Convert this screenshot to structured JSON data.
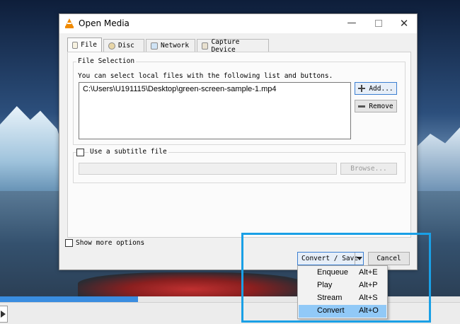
{
  "window": {
    "title": "Open Media"
  },
  "tabs": [
    {
      "label": "File",
      "icon": "file-icon"
    },
    {
      "label": "Disc",
      "icon": "disc-icon"
    },
    {
      "label": "Network",
      "icon": "network-icon"
    },
    {
      "label": "Capture Device",
      "icon": "capture-device-icon"
    }
  ],
  "file_selection": {
    "group_label": "File Selection",
    "instructions": "You can select local files with the following list and buttons.",
    "files": [
      "C:\\Users\\U191115\\Desktop\\green-screen-sample-1.mp4"
    ],
    "add_label": "Add...",
    "remove_label": "Remove"
  },
  "subtitle": {
    "checkbox_label": "Use a subtitle file",
    "browse_label": "Browse..."
  },
  "options": {
    "show_more_label": "Show more options"
  },
  "footer": {
    "primary_label": "Convert / Save",
    "cancel_label": "Cancel"
  },
  "menu": {
    "items": [
      {
        "label": "Enqueue",
        "shortcut": "Alt+E"
      },
      {
        "label": "Play",
        "shortcut": "Alt+P"
      },
      {
        "label": "Stream",
        "shortcut": "Alt+S"
      },
      {
        "label": "Convert",
        "shortcut": "Alt+O"
      }
    ],
    "selected": "Convert"
  },
  "player": {
    "seek_progress": 0.3
  },
  "colors": {
    "highlight": "#1aa0e6",
    "menu_selected": "#91c9f7",
    "seek_fill": "#3a8de0",
    "vlc_orange": "#f08a00"
  }
}
